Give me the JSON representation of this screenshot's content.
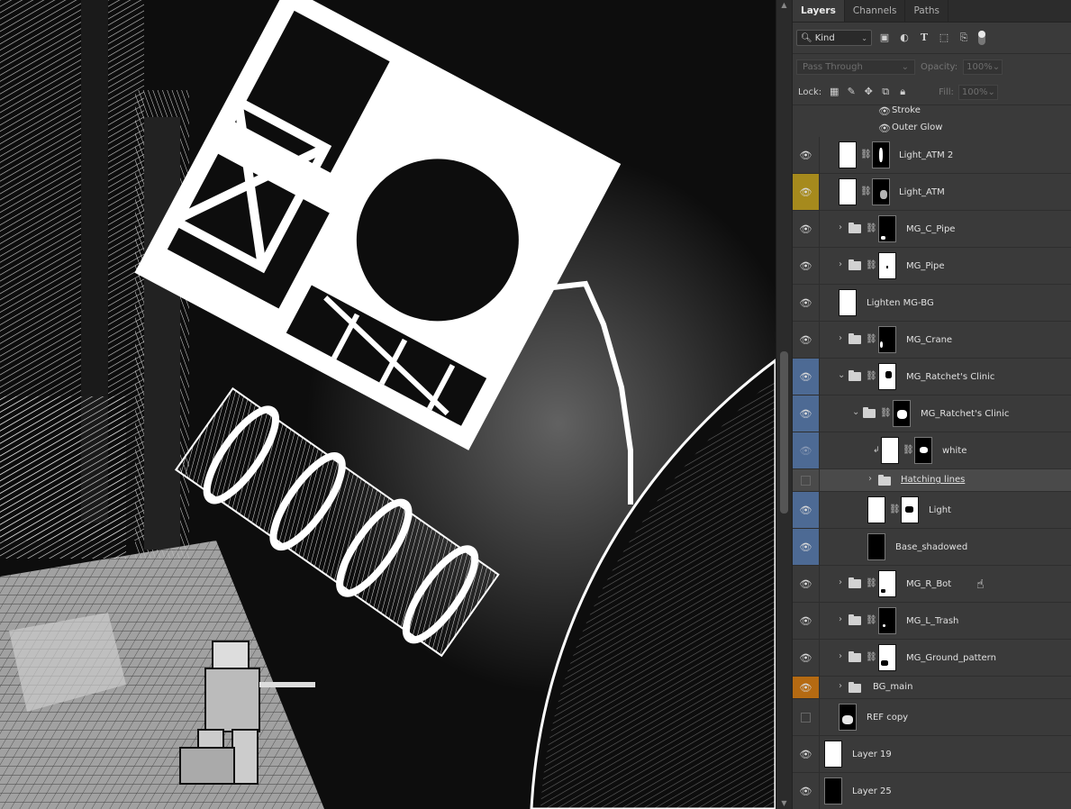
{
  "tabs": [
    {
      "label": "Layers",
      "active": true
    },
    {
      "label": "Channels",
      "active": false
    },
    {
      "label": "Paths",
      "active": false
    }
  ],
  "filter": {
    "kind_label": "Kind",
    "icons": [
      "image-filter-icon",
      "adjustment-filter-icon",
      "type-filter-icon",
      "shape-filter-icon",
      "smart-object-filter-icon"
    ]
  },
  "blend": {
    "mode": "Pass Through",
    "opacity_label": "Opacity:",
    "opacity_value": "100%",
    "lock_label": "Lock:",
    "fill_label": "Fill:",
    "fill_value": "100%"
  },
  "effects": [
    {
      "label": "Stroke"
    },
    {
      "label": "Outer Glow"
    }
  ],
  "layers": [
    {
      "name": "Light_ATM 2"
    },
    {
      "name": "Light_ATM"
    },
    {
      "name": "MG_C_Pipe"
    },
    {
      "name": "MG_Pipe"
    },
    {
      "name": "Lighten MG-BG"
    },
    {
      "name": "MG_Crane"
    },
    {
      "name": "MG_Ratchet's Clinic"
    },
    {
      "name": "MG_Ratchet's Clinic"
    },
    {
      "name": "white"
    },
    {
      "name": "Hatching lines"
    },
    {
      "name": "Light"
    },
    {
      "name": "Base_shadowed"
    },
    {
      "name": "MG_R_Bot"
    },
    {
      "name": "MG_L_Trash"
    },
    {
      "name": "MG_Ground_pattern"
    },
    {
      "name": "BG_main"
    },
    {
      "name": "REF copy"
    },
    {
      "name": "Layer 19"
    },
    {
      "name": "Layer 25"
    }
  ]
}
